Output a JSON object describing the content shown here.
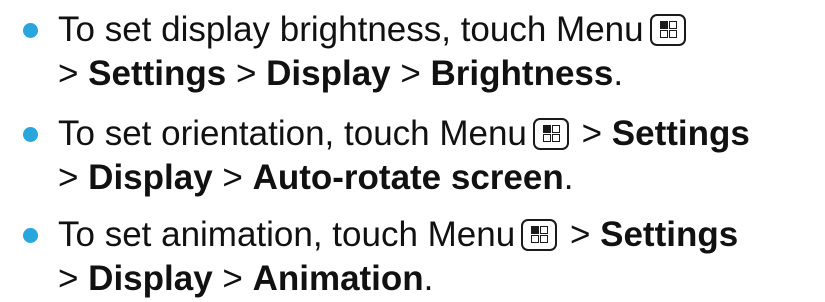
{
  "items": [
    {
      "line1_text": "To set display brightness, touch Menu",
      "icon": "menu-key-icon",
      "line2": {
        "sep1": "> ",
        "b1": "Settings",
        "sep2": " > ",
        "b2": "Display",
        "sep3": " > ",
        "b3": "Brightness",
        "end": "."
      }
    },
    {
      "line1_text": "To set orientation, touch Menu",
      "icon": "menu-key-icon",
      "line1_after": " > ",
      "line1_bold": "Settings",
      "line2": {
        "sep1": "> ",
        "b1": "Display",
        "sep2": " > ",
        "b2": "Auto-rotate screen",
        "end": "."
      }
    },
    {
      "line1_text": "To set animation, touch Menu",
      "icon": "menu-key-icon",
      "line1_after": " > ",
      "line1_bold": "Settings",
      "line2": {
        "sep1": "> ",
        "b1": "Display",
        "sep2": " > ",
        "b2": "Animation",
        "end": "."
      }
    }
  ],
  "colors": {
    "bullet": "#29a6dc",
    "text": "#111111"
  }
}
